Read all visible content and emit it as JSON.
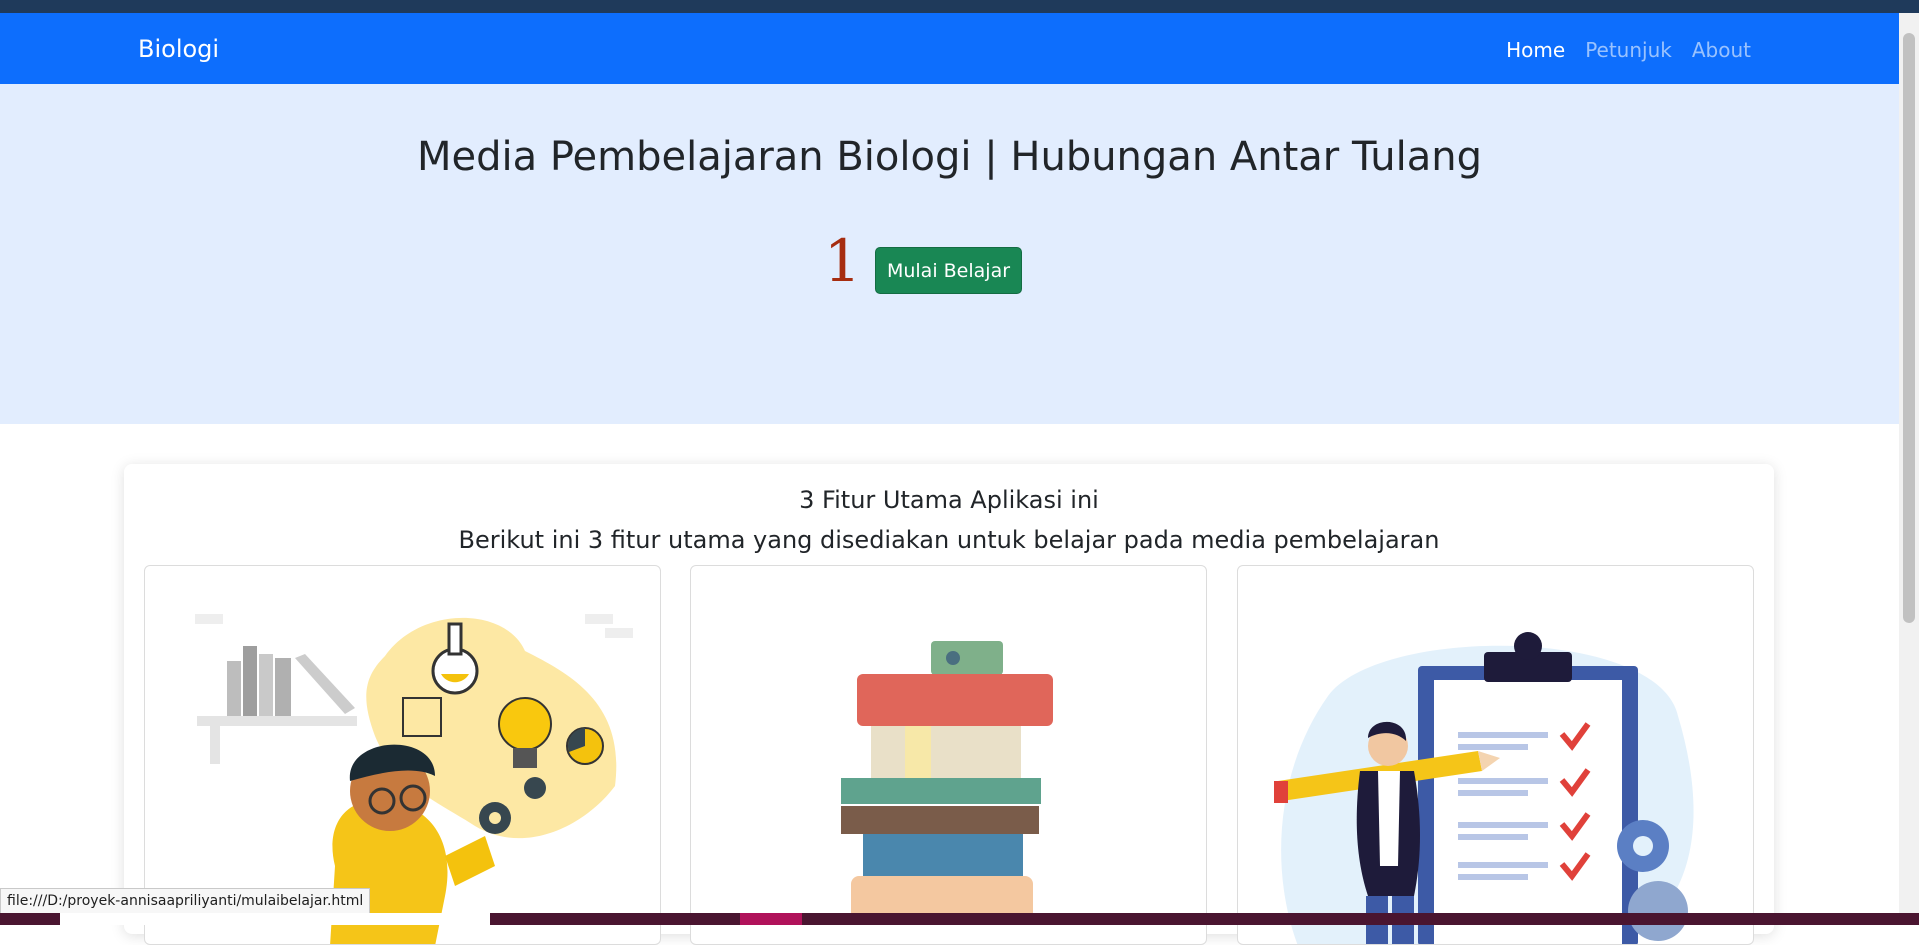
{
  "navbar": {
    "brand": "Biologi",
    "items": [
      {
        "label": "Home",
        "active": true
      },
      {
        "label": "Petunjuk",
        "active": false
      },
      {
        "label": "About",
        "active": false
      }
    ],
    "color": "#0d6efd"
  },
  "hero": {
    "title": "Media Pembelajaran Biologi | Hubungan Antar Tulang",
    "counter": "1",
    "start_button": "Mulai Belajar",
    "background": "#e2edfe"
  },
  "features": {
    "heading": "3 Fitur Utama Aplikasi ini",
    "subheading": "Berikut ini 3 fitur utama yang disediakan untuk belajar pada media pembelajaran",
    "cards": [
      {
        "image": "student-science-illustration"
      },
      {
        "image": "book-stack-illustration"
      },
      {
        "image": "checklist-clipboard-illustration"
      }
    ]
  },
  "statusbar": {
    "url": "file:///D:/proyek-annisaapriliyanti/mulaibelajar.html"
  }
}
